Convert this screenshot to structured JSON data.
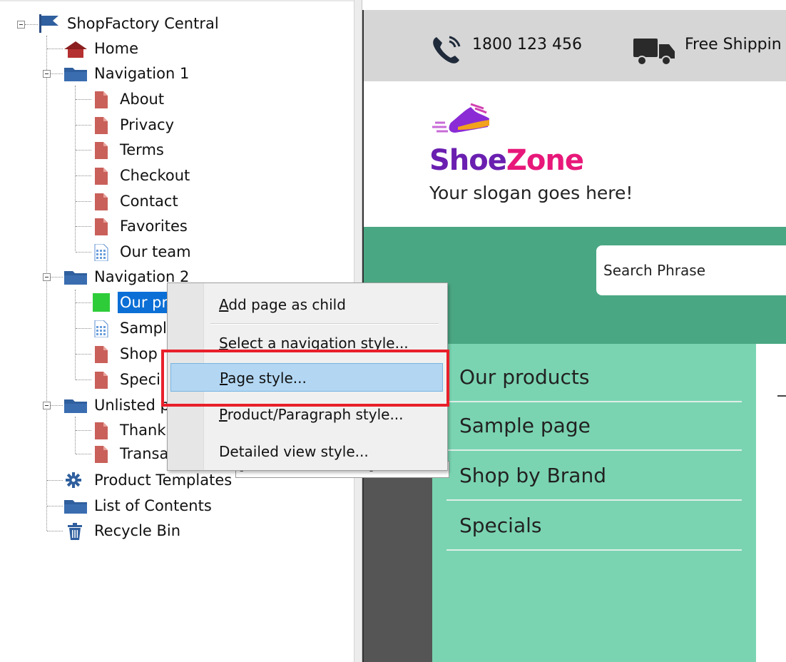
{
  "tree": {
    "root": {
      "label": "ShopFactory Central",
      "icon": "flag-icon"
    },
    "items": [
      {
        "label": "Home",
        "icon": "home-icon"
      },
      {
        "label": "Navigation 1",
        "icon": "folder-icon"
      },
      {
        "label": "About",
        "icon": "page-icon"
      },
      {
        "label": "Privacy",
        "icon": "page-icon"
      },
      {
        "label": "Terms",
        "icon": "page-icon"
      },
      {
        "label": "Checkout",
        "icon": "page-icon"
      },
      {
        "label": "Contact",
        "icon": "page-icon"
      },
      {
        "label": "Favorites",
        "icon": "page-icon"
      },
      {
        "label": "Our team",
        "icon": "grid-page-icon"
      },
      {
        "label": "Navigation 2",
        "icon": "folder-icon"
      },
      {
        "label": "Our pr",
        "icon": "green-square-icon"
      },
      {
        "label": "Sampl",
        "icon": "grid-page-icon"
      },
      {
        "label": "Shop",
        "icon": "page-icon"
      },
      {
        "label": "Speci",
        "icon": "page-icon"
      },
      {
        "label": "Unlisted p",
        "icon": "folder-icon"
      },
      {
        "label": "Thank",
        "icon": "page-icon"
      },
      {
        "label": "Transa",
        "icon": "page-icon"
      },
      {
        "label": "Product Templates",
        "icon": "gear-icon"
      },
      {
        "label": "List of Contents",
        "icon": "folder-icon"
      },
      {
        "label": "Recycle Bin",
        "icon": "trash-icon"
      }
    ]
  },
  "context_menu": {
    "items": [
      {
        "label_u": "A",
        "label_rest": "dd page as child"
      },
      {
        "label_u": "S",
        "label_rest": "elect a navigation style..."
      },
      {
        "label_u": "P",
        "label_rest": "age style..."
      },
      {
        "label_u": "P",
        "label_rest": "roduct/Paragraph style..."
      },
      {
        "label_u": "",
        "label_rest": "Detailed view style..."
      }
    ],
    "highlighted": "Page style..."
  },
  "tooltip_fragment": "[Table of Contents] of",
  "preview": {
    "phone": "1800 123 456",
    "shipping": "Free Shippin",
    "logo_shoe": "Shoe",
    "logo_zone": "Zone",
    "slogan": "Your slogan goes here!",
    "search_placeholder": "Search Phrase",
    "menu": [
      "Our products",
      "Sample page",
      "Shop by Brand",
      "Specials"
    ]
  },
  "colors": {
    "nav_green": "#4aa783",
    "menu_mint": "#7ad4b2",
    "logo_purple": "#6a1fb0",
    "logo_pink": "#e8187a",
    "selection_blue": "#0b6fd6",
    "highlight_red": "#e8202a"
  }
}
